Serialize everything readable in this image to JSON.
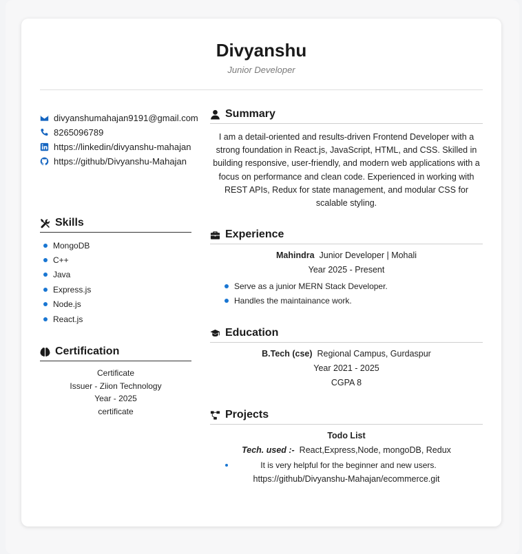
{
  "header": {
    "name": "Divyanshu",
    "title": "Junior Developer"
  },
  "contact": {
    "email": "divyanshumahajan9191@gmail.com",
    "phone": "8265096789",
    "linkedin": "https://linkedin/divyanshu-mahajan",
    "github": "https://github/Divyanshu-Mahajan"
  },
  "skills": {
    "heading": "Skills",
    "items": [
      "MongoDB",
      "C++",
      "Java",
      "Express.js",
      "Node.js",
      "React.js"
    ]
  },
  "certification": {
    "heading": "Certification",
    "name": "Certificate",
    "issuer": "Issuer - Ziion Technology",
    "year": "Year - 2025",
    "link": "certificate"
  },
  "summary": {
    "heading": "Summary",
    "text": "I am a detail-oriented and results-driven Frontend Developer with a strong foundation in React.js, JavaScript, HTML, and CSS. Skilled in building responsive, user-friendly, and modern web applications with a focus on performance and clean code. Experienced in working with REST APIs, Redux for state management, and modular CSS for scalable styling."
  },
  "experience": {
    "heading": "Experience",
    "company": "Mahindra",
    "role": "Junior Developer | Mohali",
    "period": "Year 2025 - Present",
    "points": [
      "Serve as a junior MERN Stack Developer.",
      "Handles the maintainance work."
    ]
  },
  "education": {
    "heading": "Education",
    "degree": "B.Tech (cse)",
    "institute": "Regional Campus, Gurdaspur",
    "period": "Year 2021 - 2025",
    "cgpa": "CGPA 8"
  },
  "projects": {
    "heading": "Projects",
    "name": "Todo List",
    "tech_label": "Tech. used :-",
    "tech": "React,Express,Node, mongoDB, Redux",
    "description": "It is very helpful for the beginner and new users.",
    "link": "https://github/Divyanshu-Mahajan/ecommerce.git"
  },
  "colors": {
    "accent": "#1976d2",
    "text": "#1a1a1a",
    "subtitle": "#7a7a7a"
  },
  "icons": {
    "email": "envelope-icon",
    "phone": "phone-icon",
    "linkedin": "linkedin-icon",
    "github": "github-icon",
    "skills": "tools-icon",
    "certification": "brain-icon",
    "summary": "user-icon",
    "experience": "briefcase-icon",
    "education": "graduation-cap-icon",
    "projects": "diagram-icon"
  }
}
